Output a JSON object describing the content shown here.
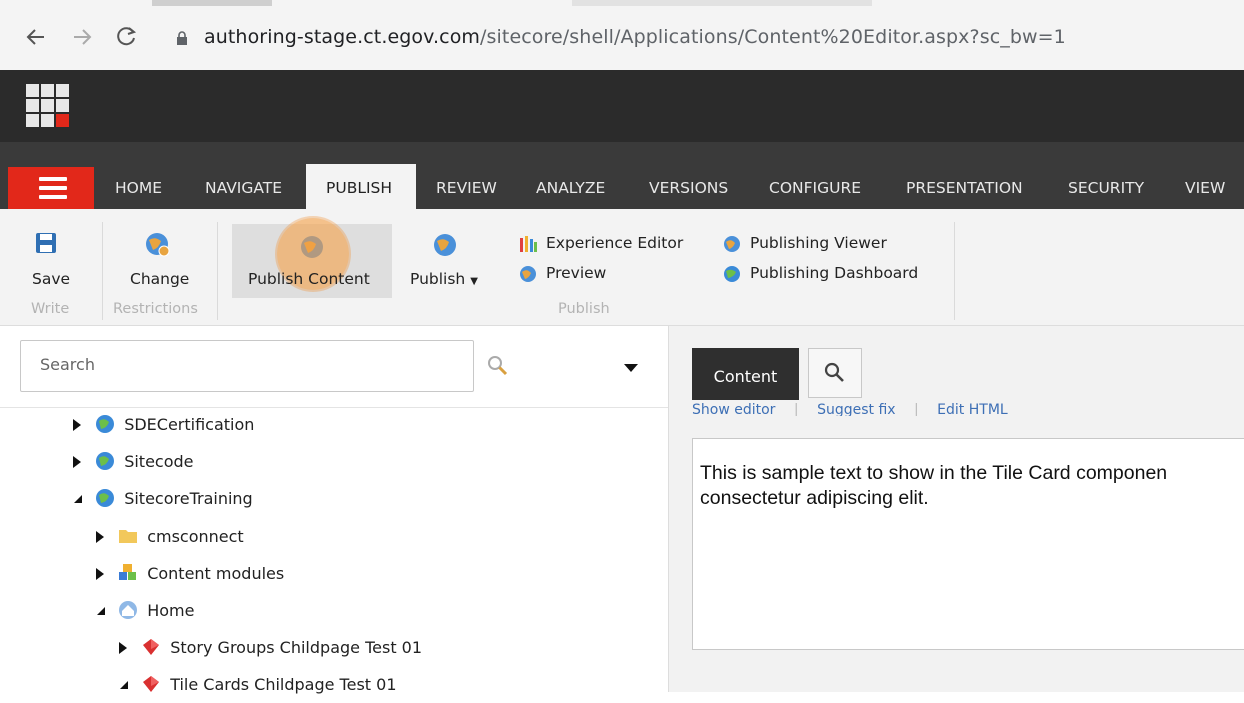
{
  "browser": {
    "back_icon": "arrow-left-icon",
    "forward_icon": "arrow-right-icon",
    "reload_icon": "reload-icon",
    "url_host": "authoring-stage.ct.egov.com",
    "url_path": "/sitecore/shell/Applications/Content%20Editor.aspx?sc_bw=1"
  },
  "tabs": [
    "HOME",
    "NAVIGATE",
    "PUBLISH",
    "REVIEW",
    "ANALYZE",
    "VERSIONS",
    "CONFIGURE",
    "PRESENTATION",
    "SECURITY",
    "VIEW"
  ],
  "active_tab": "PUBLISH",
  "ribbon": {
    "save": "Save",
    "change": "Change",
    "publish_content": "Publish Content",
    "publish": "Publish",
    "experience_editor": "Experience Editor",
    "preview": "Preview",
    "publishing_viewer": "Publishing Viewer",
    "publishing_dashboard": "Publishing Dashboard",
    "groups": {
      "write": "Write",
      "restrictions": "Restrictions",
      "publish": "Publish"
    }
  },
  "search": {
    "placeholder": "Search"
  },
  "tree": [
    {
      "label": "SDECertification",
      "icon": "globe-icon",
      "expanded": false
    },
    {
      "label": "Sitecode",
      "icon": "globe-icon",
      "expanded": false
    },
    {
      "label": "SitecoreTraining",
      "icon": "globe-icon",
      "expanded": true
    },
    {
      "label": "cmsconnect",
      "icon": "folder-icon",
      "expanded": false
    },
    {
      "label": "Content modules",
      "icon": "modules-icon",
      "expanded": false
    },
    {
      "label": "Home",
      "icon": "home-icon",
      "expanded": true
    },
    {
      "label": "Story Groups Childpage Test 01",
      "icon": "page-icon",
      "expanded": false
    },
    {
      "label": "Tile Cards Childpage Test 01",
      "icon": "page-icon",
      "expanded": true
    }
  ],
  "content": {
    "tab_label": "Content",
    "editor_links": [
      "Show editor",
      "Suggest fix",
      "Edit HTML"
    ],
    "editor_line1": "This is sample text to show in the Tile Card componen",
    "editor_line2": "consectetur adipiscing elit."
  },
  "colors": {
    "accent_red": "#e2281a",
    "dark_bar": "#2b2b2b",
    "tab_bar": "#3a3a3a",
    "link_blue": "#3d6fb5",
    "click_highlight": "#f5a046"
  }
}
